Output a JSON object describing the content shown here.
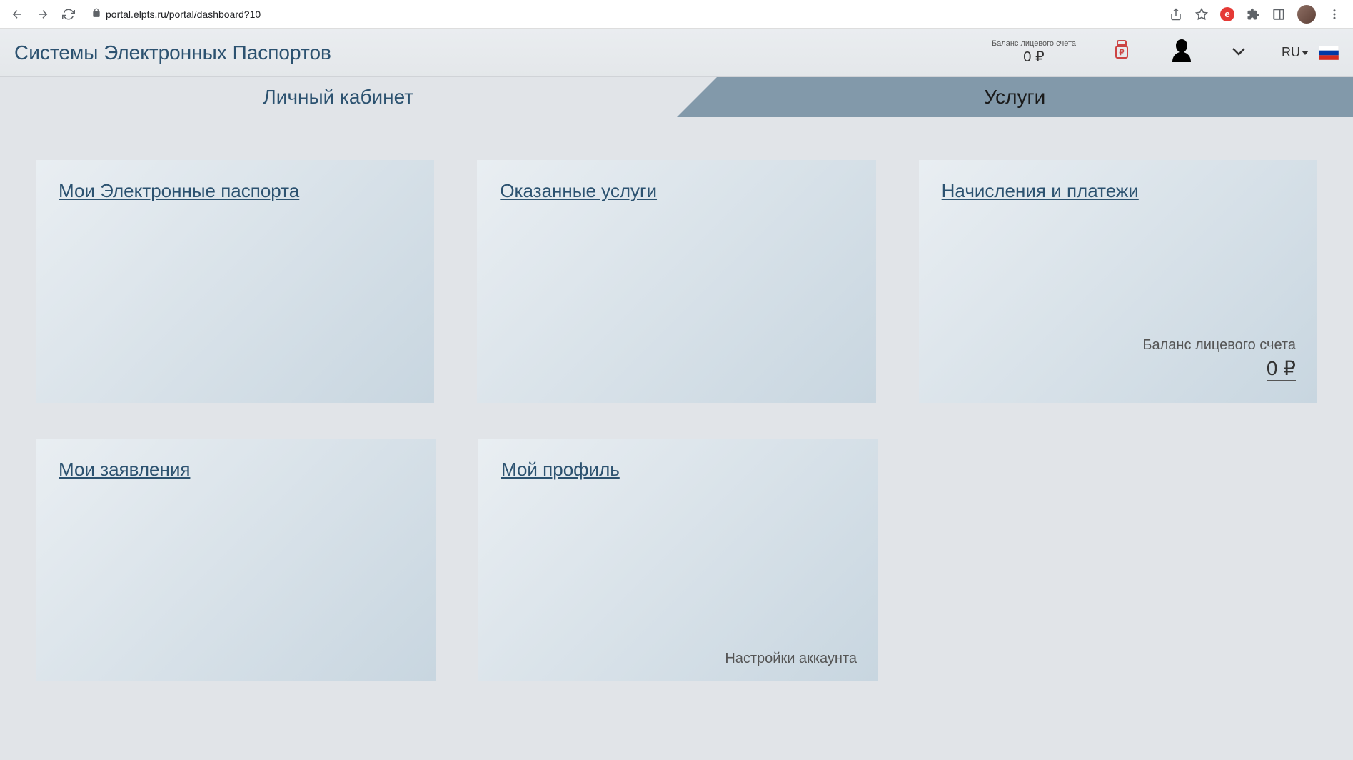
{
  "browser": {
    "url": "portal.elpts.ru/portal/dashboard?10"
  },
  "header": {
    "site_title": "Системы Электронных Паспортов",
    "balance_label": "Баланс лицевого счета",
    "balance_value": "0 ₽",
    "language": "RU"
  },
  "tabs": {
    "cabinet": "Личный кабинет",
    "services": "Услуги"
  },
  "cards": {
    "passports": "Мои Электронные паспорта",
    "rendered_services": "Оказанные услуги",
    "payments": "Начисления и платежи",
    "payments_balance_label": "Баланс лицевого счета",
    "payments_balance_value": "0 ₽",
    "applications": "Мои заявления",
    "profile": "Мой профиль",
    "profile_settings": "Настройки аккаунта"
  }
}
